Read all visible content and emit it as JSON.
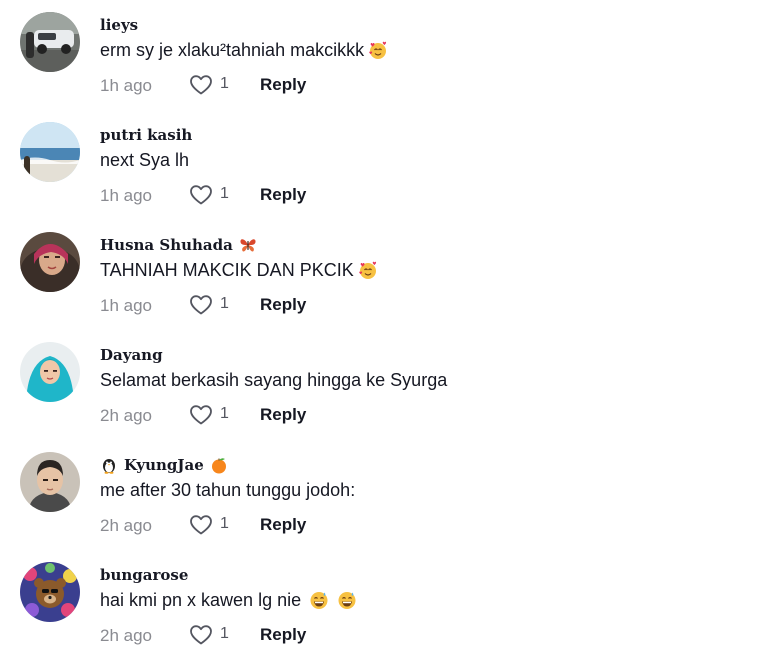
{
  "comments": [
    {
      "username": "lieys",
      "text": "erm sy je xlaku²tahniah makcikkk",
      "text_emoji": [
        "smiling-face-with-hearts"
      ],
      "time": "1h ago",
      "likes": "1",
      "reply_label": "Reply",
      "avatar": "car-photo"
    },
    {
      "username": "putri kasih",
      "text": "next Sya lh",
      "text_emoji": [],
      "time": "1h ago",
      "likes": "1",
      "reply_label": "Reply",
      "avatar": "beach-photo"
    },
    {
      "username": "Husna Shuhada",
      "name_suffix_emoji": "butterfly",
      "text": "TAHNIAH MAKCIK DAN PKCIK",
      "text_emoji": [
        "smiling-face-with-hearts"
      ],
      "time": "1h ago",
      "likes": "1",
      "reply_label": "Reply",
      "avatar": "hijab-photo"
    },
    {
      "username": "Dayang",
      "text": "Selamat berkasih sayang hingga ke Syurga",
      "text_emoji": [],
      "time": "2h ago",
      "likes": "1",
      "reply_label": "Reply",
      "avatar": "cyan-hijab-photo"
    },
    {
      "username": "KyungJae",
      "name_prefix_emoji": "penguin",
      "name_suffix_emoji": "tangerine",
      "text": "me after 30 tahun tunggu jodoh:",
      "text_emoji": [],
      "time": "2h ago",
      "likes": "1",
      "reply_label": "Reply",
      "avatar": "man-portrait"
    },
    {
      "username": "bungarose",
      "text": "hai kmi pn x kawen lg nie",
      "text_emoji": [
        "grinning-face-with-sweat",
        "grinning-face-with-sweat"
      ],
      "time": "2h ago",
      "likes": "1",
      "reply_label": "Reply",
      "avatar": "bear-flowers"
    }
  ],
  "colors": {
    "text_primary": "#161823",
    "text_secondary": "#8a8b91",
    "like_icon": "#545660"
  }
}
